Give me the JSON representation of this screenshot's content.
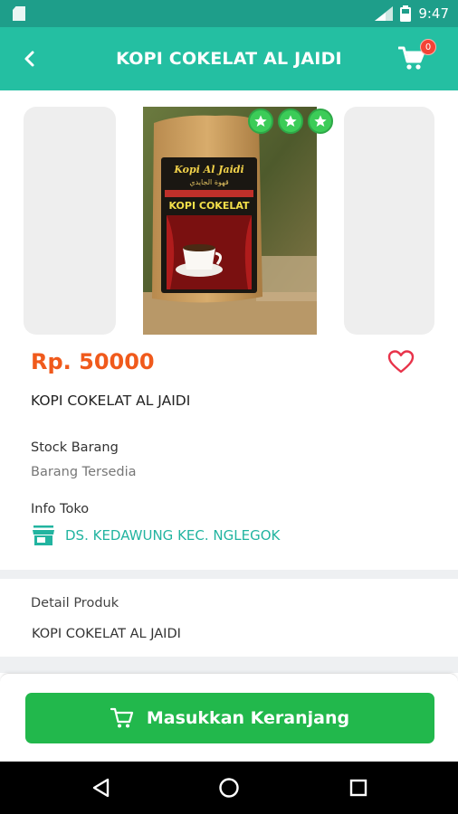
{
  "status_bar": {
    "time": "9:47",
    "icons": [
      "sd-card-icon",
      "signal-icon",
      "battery-icon"
    ]
  },
  "app_bar": {
    "title": "KOPI COKELAT AL JAIDI",
    "cart_count": "0",
    "color": "#24bfa2"
  },
  "product": {
    "price": "Rp. 50000",
    "name": "KOPI COKELAT AL JAIDI",
    "rating_stars": 3,
    "image_label_1": "Kopi Al Jaidi",
    "image_label_2": "KOPI COKELAT"
  },
  "stock": {
    "label": "Stock Barang",
    "value": "Barang Tersedia"
  },
  "store": {
    "label": "Info Toko",
    "name": "DS. KEDAWUNG KEC. NGLEGOK"
  },
  "detail": {
    "label": "Detail Produk",
    "text": "KOPI COKELAT AL JAIDI"
  },
  "actions": {
    "add_to_cart_label": "Masukkan Keranjang",
    "button_color": "#22b84c"
  }
}
